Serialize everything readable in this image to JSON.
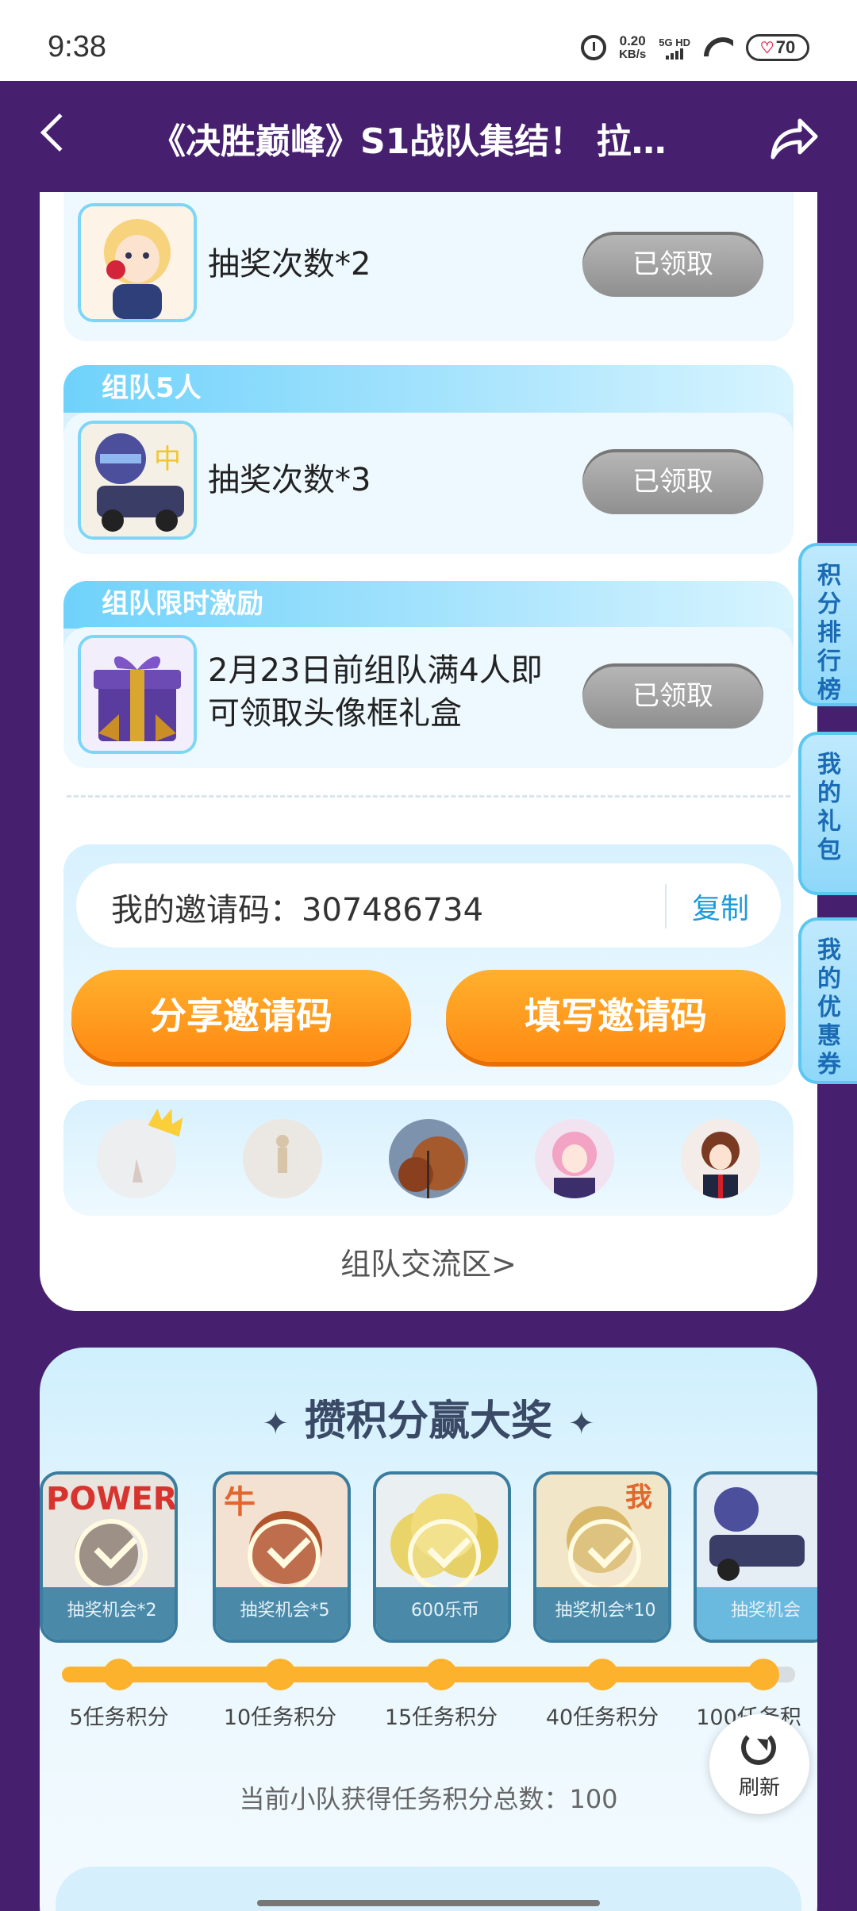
{
  "status_bar": {
    "time": "9:38",
    "net_speed": "0.20",
    "net_unit": "KB/s",
    "network": "5G HD",
    "battery": "70"
  },
  "header": {
    "title": "《决胜巅峰》S1战队集结！ 拉…"
  },
  "rewards": [
    {
      "tag": "",
      "text": "抽奖次数*2",
      "status": "已领取"
    },
    {
      "tag": "组队5人",
      "text": "抽奖次数*3",
      "status": "已领取"
    },
    {
      "tag": "组队限时激励",
      "text_line1": "2月23日前组队满4人即",
      "text_line2": "可领取头像框礼盒",
      "status": "已领取"
    }
  ],
  "invite": {
    "label": "我的邀请码：307486734",
    "copy": "复制",
    "share_button": "分享邀请码",
    "fill_button": "填写邀请码"
  },
  "team_exchange": "组队交流区>",
  "side_tabs": [
    "积分排行榜",
    "我的礼包",
    "我的优惠券"
  ],
  "points": {
    "title": "攒积分赢大奖",
    "prizes": [
      {
        "caption": "抽奖机会*2",
        "milestone": "5任务积分",
        "claimed": true
      },
      {
        "caption": "抽奖机会*5",
        "milestone": "10任务积分",
        "claimed": true
      },
      {
        "caption": "600乐币",
        "milestone": "15任务积分",
        "claimed": true
      },
      {
        "caption": "抽奖机会*10",
        "milestone": "40任务积分",
        "claimed": true
      },
      {
        "caption": "抽奖机会",
        "milestone": "100任务积",
        "claimed": false
      }
    ],
    "total": "当前小队获得任务积分总数：100"
  },
  "refresh": "刷新",
  "colors": {
    "background": "#46206e",
    "accent_orange": "#ff8a12",
    "accent_blue": "#1e9bd8",
    "claimed_gray": "#9a9a9a"
  }
}
